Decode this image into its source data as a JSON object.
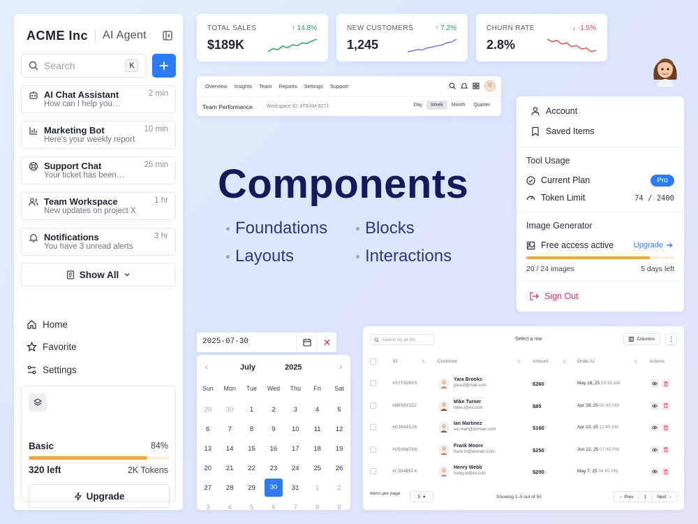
{
  "sidebar": {
    "brand": "ACME Inc",
    "agent": "AI Agent",
    "search_placeholder": "Search",
    "search_shortcut": "K",
    "chats": [
      {
        "title": "AI Chat Assistant",
        "subtitle": "How can I help you…",
        "time": "2 min",
        "icon": "robot-icon"
      },
      {
        "title": "Marketing Bot",
        "subtitle": "Here's your weekly report",
        "time": "10 min",
        "icon": "bar-chart-icon"
      },
      {
        "title": "Support Chat",
        "subtitle": "Your ticket has been…",
        "time": "25 min",
        "icon": "lifebuoy-icon"
      },
      {
        "title": "Team Workspace",
        "subtitle": "New updates on project X",
        "time": "1 hr",
        "icon": "users-icon"
      },
      {
        "title": "Notifications",
        "subtitle": "You have 3 unread alerts",
        "time": "3 hr",
        "icon": "bell-icon"
      }
    ],
    "show_all": "Show All",
    "nav": [
      {
        "label": "Home",
        "icon": "home-icon"
      },
      {
        "label": "Favorite",
        "icon": "star-icon"
      },
      {
        "label": "Settings",
        "icon": "sliders-icon"
      }
    ],
    "plan": {
      "name": "Basic",
      "percent_label": "84%",
      "percent": 0.84,
      "left": "320 left",
      "tokens": "2K Tokens",
      "upgrade": "Upgrade"
    }
  },
  "stats": [
    {
      "label": "TOTAL SALES",
      "value": "$189K",
      "change": "14.8%",
      "direction": "up",
      "color": "#22a05a",
      "trend": [
        3,
        4,
        3.6,
        4.8,
        4.2,
        5.2,
        4.9,
        5.8,
        5.6,
        6.4,
        7
      ]
    },
    {
      "label": "NEW CUSTOMERS",
      "value": "1,245",
      "change": "7.2%",
      "direction": "up",
      "color": "#6b6fe6",
      "trend": [
        3,
        3.2,
        3.5,
        3.4,
        3.9,
        4.1,
        4.4,
        4.6,
        5.1,
        5.3,
        6
      ]
    },
    {
      "label": "CHURN RATE",
      "value": "2.8%",
      "change": "-1.5%",
      "direction": "down",
      "color": "#e04848",
      "trend": [
        6,
        5.8,
        5.9,
        5.6,
        5.7,
        5.4,
        5.5,
        5.2,
        5.3,
        5.0,
        5.1
      ]
    }
  ],
  "topnav": {
    "tabs": [
      "Overview",
      "Insights",
      "Team",
      "Reports",
      "Settings",
      "Support"
    ],
    "title": "Team Performance",
    "workspace": "Workspace ID: #TEAM-9271",
    "periods": [
      "Day",
      "Week",
      "Month",
      "Quarter"
    ],
    "active_period": "Week"
  },
  "hero": {
    "title": "Components",
    "items": [
      "Foundations",
      "Blocks",
      "Layouts",
      "Interactions"
    ]
  },
  "menu": {
    "account": "Account",
    "saved": "Saved Items",
    "tool_usage": "Tool Usage",
    "current_plan": "Current Plan",
    "plan_badge": "Pro",
    "token_limit": "Token Limit",
    "token_value": "74 / 2400",
    "image_gen": "Image Generator",
    "free_access": "Free access active",
    "upgrade": "Upgrade",
    "images_used": 20,
    "images_total": 24,
    "images_label": "20 / 24 images",
    "days_left": "5 days left",
    "sign_out": "Sign Out"
  },
  "datepicker": {
    "value": "2025-07-30",
    "month": "July",
    "year": "2025",
    "weekdays": [
      "Sun",
      "Mon",
      "Tue",
      "Wed",
      "Thu",
      "Fri",
      "Sat"
    ],
    "weeks": [
      [
        {
          "d": "29",
          "o": true
        },
        {
          "d": "30",
          "o": true
        },
        {
          "d": "1"
        },
        {
          "d": "2"
        },
        {
          "d": "3"
        },
        {
          "d": "4"
        },
        {
          "d": "5"
        }
      ],
      [
        {
          "d": "6"
        },
        {
          "d": "7"
        },
        {
          "d": "8"
        },
        {
          "d": "9"
        },
        {
          "d": "10"
        },
        {
          "d": "11"
        },
        {
          "d": "12"
        }
      ],
      [
        {
          "d": "13"
        },
        {
          "d": "14"
        },
        {
          "d": "15"
        },
        {
          "d": "16"
        },
        {
          "d": "17"
        },
        {
          "d": "18"
        },
        {
          "d": "19"
        }
      ],
      [
        {
          "d": "20"
        },
        {
          "d": "21"
        },
        {
          "d": "22"
        },
        {
          "d": "23"
        },
        {
          "d": "24"
        },
        {
          "d": "25"
        },
        {
          "d": "26"
        }
      ],
      [
        {
          "d": "27"
        },
        {
          "d": "28"
        },
        {
          "d": "29"
        },
        {
          "d": "30",
          "s": true
        },
        {
          "d": "31"
        },
        {
          "d": "1",
          "o": true
        },
        {
          "d": "2",
          "o": true
        }
      ],
      [
        {
          "d": "3",
          "o": true
        },
        {
          "d": "4",
          "o": true
        },
        {
          "d": "5",
          "o": true
        },
        {
          "d": "6",
          "o": true
        },
        {
          "d": "7",
          "o": true
        },
        {
          "d": "8",
          "o": true
        },
        {
          "d": "9",
          "o": true
        }
      ]
    ]
  },
  "table": {
    "search_placeholder": "Search by all fiel",
    "select_row": "Select a row",
    "columns_btn": "Columns",
    "more": "⋮",
    "headers": {
      "id": "ID",
      "customer": "Customer",
      "amount": "Amount",
      "order_at": "Order At",
      "actions": "Actions"
    },
    "rows": [
      {
        "id": "#S7T8U9V0",
        "name": "Yara Brooks",
        "email": "yara.b@mail.com",
        "amount": "$260",
        "date": "May 18, 25",
        "time": "08:45 AM",
        "avatar_color": "#c98a6a"
      },
      {
        "id": "#W9X0Y1Z2",
        "name": "Mike Turner",
        "email": "mike.t@ex.com",
        "amount": "$85",
        "date": "Apr 28, 25",
        "time": "02:45 AM",
        "avatar_color": "#6a4a3a"
      },
      {
        "id": "#G3H4I5J6",
        "name": "Ian Martinez",
        "email": "ian.mart@domain.com",
        "amount": "$160",
        "date": "Apr 23, 25",
        "time": "11:45 AM",
        "avatar_color": "#8a5a3a"
      },
      {
        "id": "#U5V6W7X8",
        "name": "Frank Moore",
        "email": "frank.m@domain.com",
        "amount": "$250",
        "date": "Jun 22, 25",
        "time": "07:45 PM",
        "avatar_color": "#d07a50"
      },
      {
        "id": "#C3D4E5F6",
        "name": "Henry Webb",
        "email": "henry.w@ex.com",
        "amount": "$200",
        "date": "May 7, 25",
        "time": "04:45 PM",
        "avatar_color": "#a0a0a8"
      }
    ],
    "items_per_page": "Items per page",
    "per_page_value": "5",
    "showing": "Showing 1–5 out of 50",
    "prev": "Prev",
    "page": "1",
    "next": "Next"
  }
}
